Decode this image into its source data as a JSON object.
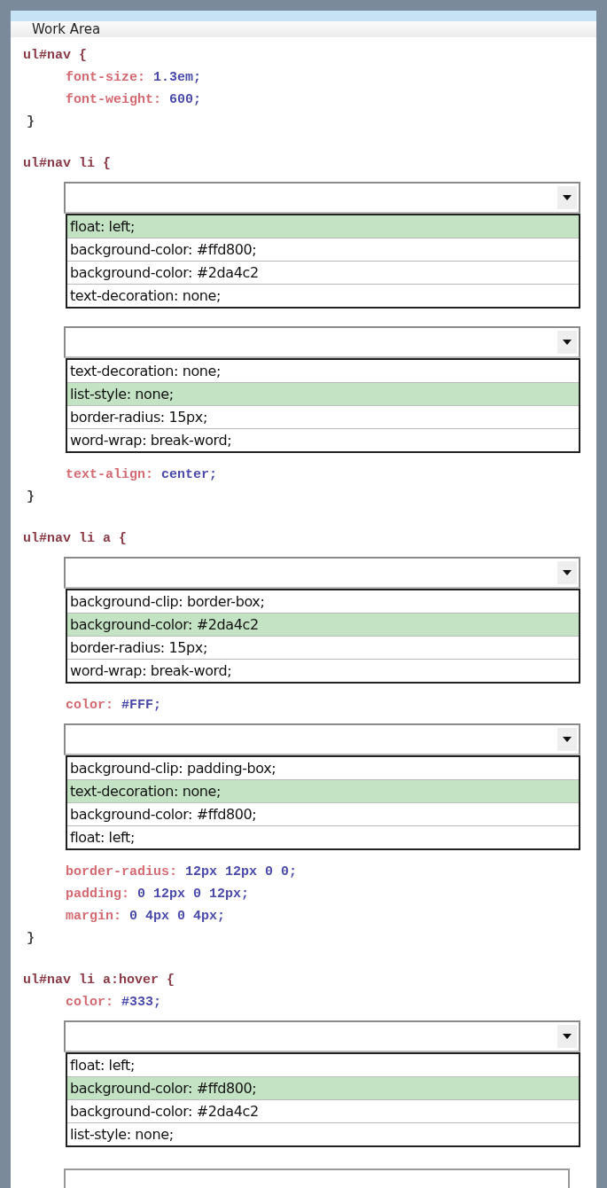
{
  "panel": {
    "title": "Work Area"
  },
  "blocks": [
    {
      "kind": "selector",
      "text": "ul#nav {"
    },
    {
      "kind": "decl",
      "property": "font-size:",
      "value": "1.3em;"
    },
    {
      "kind": "decl",
      "property": "font-weight:",
      "value": "600;"
    },
    {
      "kind": "brace",
      "text": "}"
    },
    {
      "kind": "selector",
      "text": "ul#nav li {"
    },
    {
      "kind": "dropdown",
      "options": [
        {
          "text": "float: left;",
          "selected": true
        },
        {
          "text": "background-color: #ffd800;",
          "selected": false
        },
        {
          "text": "background-color: #2da4c2",
          "selected": false
        },
        {
          "text": "text-decoration: none;",
          "selected": false
        }
      ]
    },
    {
      "kind": "dropdown",
      "options": [
        {
          "text": "text-decoration: none;",
          "selected": false
        },
        {
          "text": "list-style: none;",
          "selected": true
        },
        {
          "text": "border-radius: 15px;",
          "selected": false
        },
        {
          "text": "word-wrap: break-word;",
          "selected": false
        }
      ]
    },
    {
      "kind": "decl",
      "property": "text-align:",
      "value": "center;"
    },
    {
      "kind": "brace",
      "text": "}"
    },
    {
      "kind": "selector",
      "text": "ul#nav li a {"
    },
    {
      "kind": "dropdown",
      "options": [
        {
          "text": "background-clip: border-box;",
          "selected": false
        },
        {
          "text": "background-color: #2da4c2",
          "selected": true
        },
        {
          "text": "border-radius: 15px;",
          "selected": false
        },
        {
          "text": "word-wrap: break-word;",
          "selected": false
        }
      ]
    },
    {
      "kind": "decl",
      "property": "color:",
      "value": "#FFF;"
    },
    {
      "kind": "dropdown",
      "options": [
        {
          "text": "background-clip: padding-box;",
          "selected": false
        },
        {
          "text": "text-decoration: none;",
          "selected": true
        },
        {
          "text": "background-color: #ffd800;",
          "selected": false
        },
        {
          "text": "float: left;",
          "selected": false
        }
      ]
    },
    {
      "kind": "decl",
      "property": "border-radius:",
      "value": "12px 12px 0 0;"
    },
    {
      "kind": "decl",
      "property": "padding:",
      "value": "0 12px 0 12px;"
    },
    {
      "kind": "decl",
      "property": "margin:",
      "value": "0 4px 0 4px;"
    },
    {
      "kind": "brace",
      "text": "}"
    },
    {
      "kind": "selector",
      "text": "ul#nav li a:hover {"
    },
    {
      "kind": "decl",
      "property": "color:",
      "value": "#333;"
    },
    {
      "kind": "dropdown",
      "options": [
        {
          "text": "float: left;",
          "selected": false
        },
        {
          "text": "background-color: #ffd800;",
          "selected": true
        },
        {
          "text": "background-color: #2da4c2",
          "selected": false
        },
        {
          "text": "list-style: none;",
          "selected": false
        }
      ]
    },
    {
      "kind": "cut_dropdown"
    }
  ]
}
